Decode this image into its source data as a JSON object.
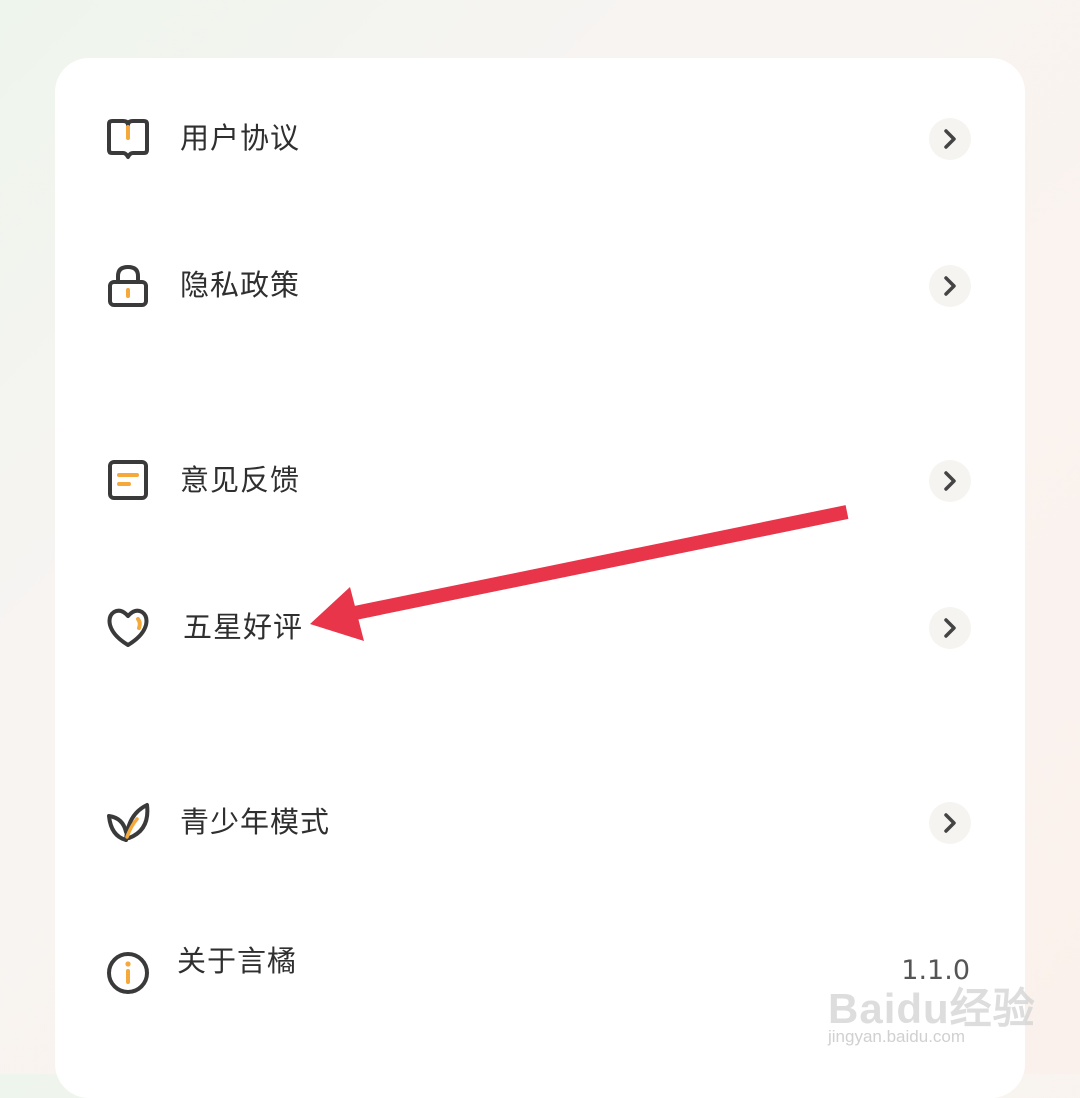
{
  "settings_menu": {
    "items": [
      {
        "label": "用户协议",
        "icon": "book-icon"
      },
      {
        "label": "隐私政策",
        "icon": "lock-icon"
      },
      {
        "label": "意见反馈",
        "icon": "feedback-icon"
      },
      {
        "label": "五星好评",
        "icon": "heart-icon"
      },
      {
        "label": "青少年模式",
        "icon": "leaf-icon"
      },
      {
        "label": "关于言橘",
        "icon": "info-icon",
        "value": "1.1.0"
      }
    ],
    "accent_color": "#f5a93a",
    "icon_color": "#3a3a3a"
  },
  "annotation": {
    "arrow_color": "#e8354a"
  },
  "watermark": {
    "logo": "Baidu经验",
    "url": "jingyan.baidu.com"
  }
}
